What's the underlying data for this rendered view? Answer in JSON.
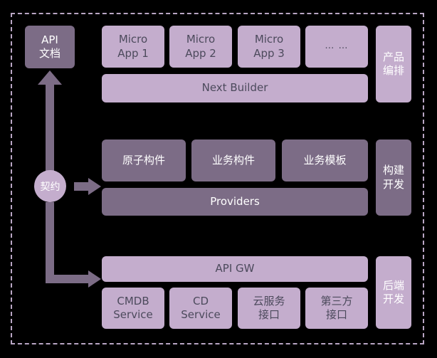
{
  "diagram": {
    "title": "Next Builder platform layered architecture",
    "background": "#000000",
    "colors": {
      "light_fill": "#c4adcd",
      "dark_fill": "#7c6c86",
      "light_text": "#4c4a5c",
      "dark_text": "#ffffff",
      "boundary": "#b9a6c4",
      "arrow": "#7c6c86"
    }
  },
  "left_column": {
    "api_doc": "API\n文档",
    "contract": "契约"
  },
  "lanes": [
    {
      "id": "product",
      "label": "产品\n编排"
    },
    {
      "id": "build",
      "label": "构建\n开发"
    },
    {
      "id": "backend",
      "label": "后端\n开发"
    }
  ],
  "rows": {
    "top": {
      "apps": [
        {
          "label": "Micro\nApp 1"
        },
        {
          "label": "Micro\nApp 2"
        },
        {
          "label": "Micro\nApp 3"
        },
        {
          "label": "… …"
        }
      ],
      "bar": "Next Builder"
    },
    "middle": {
      "components": [
        {
          "label": "原子构件"
        },
        {
          "label": "业务构件"
        },
        {
          "label": "业务模板"
        }
      ],
      "bar": "Providers"
    },
    "bottom": {
      "bar": "API GW",
      "services": [
        {
          "label": "CMDB\nService"
        },
        {
          "label": "CD\nService"
        },
        {
          "label": "云服务\n接口"
        },
        {
          "label": "第三方\n接口"
        }
      ]
    }
  },
  "arrows": [
    {
      "id": "contract-to-api-doc",
      "direction": "up"
    },
    {
      "id": "contract-to-components",
      "direction": "right"
    },
    {
      "id": "contract-to-api-gw",
      "direction": "down-right"
    }
  ]
}
